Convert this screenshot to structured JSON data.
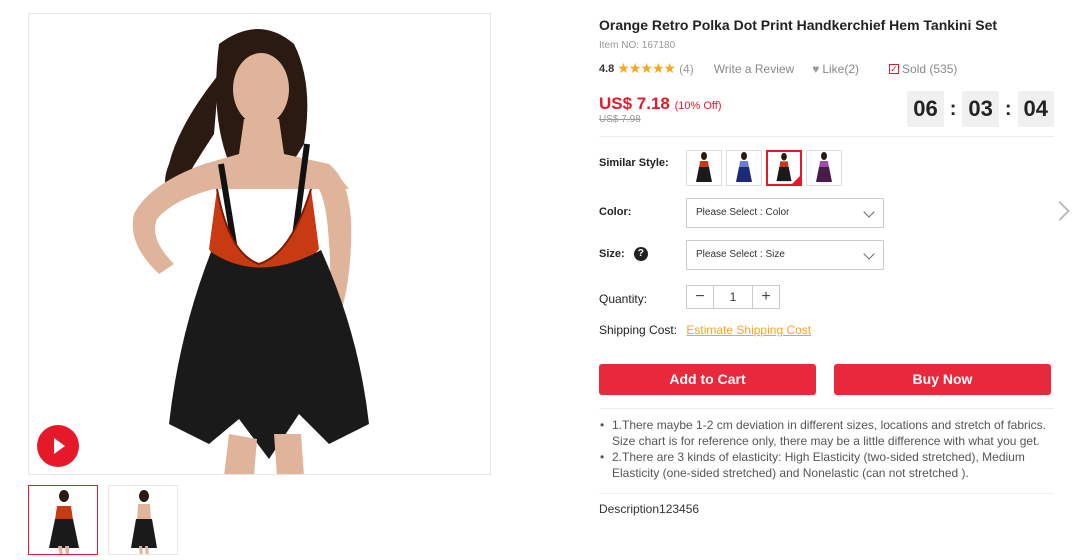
{
  "product": {
    "title": "Orange Retro Polka Dot Print Handkerchief Hem Tankini Set",
    "item_no": "Item NO: 167180",
    "rating": "4.8",
    "stars": "★★★★★",
    "review_count": "(4)",
    "write_review": "Write a Review",
    "like": "Like(2)",
    "sold": "Sold (535)",
    "price": "US$ 7.18",
    "discount": "(10% Off)",
    "old_price": "US$ 7.98",
    "countdown": [
      "06",
      "03",
      "04"
    ],
    "countdown_sep": ":"
  },
  "options": {
    "similar_label": "Similar Style:",
    "similar_count": 4,
    "color_label": "Color:",
    "color_placeholder": "Please Select : Color",
    "size_label": "Size:",
    "size_help": "?",
    "size_placeholder": "Please Select : Size",
    "quantity_label": "Quantity:",
    "quantity_value": "1",
    "minus": "−",
    "plus": "+",
    "shipping_label": "Shipping Cost:",
    "shipping_link": "Estimate Shipping Cost"
  },
  "actions": {
    "add_to_cart": "Add to Cart",
    "buy_now": "Buy Now"
  },
  "notes": [
    "1.There maybe 1-2 cm deviation in different sizes, locations and stretch of fabrics. Size chart is for reference only, there may be a little difference with what you get.",
    "2.There are 3 kinds of elasticity: High Elasticity (two-sided stretched), Medium Elasticity (one-sided stretched) and Nonelastic (can not stretched )."
  ],
  "description_tab": "Description123456",
  "colors": {
    "accent": "#e8182b",
    "star": "#f5a623",
    "swim_orange": "#c83a12",
    "swim_black": "#1a1a1a"
  }
}
